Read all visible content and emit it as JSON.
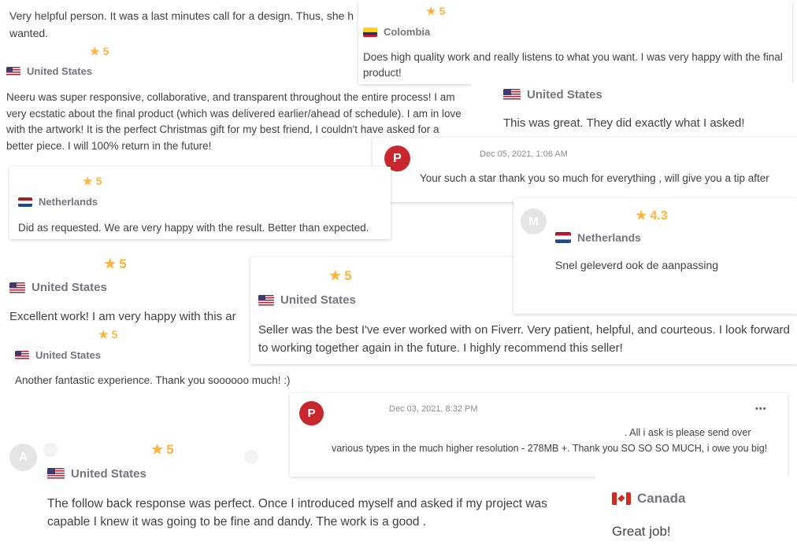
{
  "colors": {
    "star": "#ffb33e",
    "avatar_red": "#c8272e",
    "avatar_grey": "#e4e5e7",
    "country_text": "#74767e",
    "body_text": "#404145"
  },
  "cards": {
    "c1": {
      "text": "Very helpful person. It was a last minutes call for a design. Thus, she h",
      "text2": "wanted."
    },
    "c2": {
      "rating": "5",
      "country": "Colombia",
      "flag": "colombia-flag",
      "text": "Does high quality work and really listens to what you want. I was very happy with the final product!"
    },
    "c3": {
      "rating": "5",
      "country": "United States",
      "flag": "usa-flag",
      "text": "Neeru was super responsive, collaborative, and transparent throughout the entire process! I am very ecstatic about the final product (which was delivered earlier/ahead of schedule). I am in love with the artwork! It is the perfect Christmas gift for my best friend, I couldn't have asked for a better piece. I will 100% return in the future!"
    },
    "c4": {
      "country": "United States",
      "flag": "usa-flag",
      "text": "This was great. They did exactly what I asked!"
    },
    "c5": {
      "avatar": "P",
      "date": "Dec 05, 2021, 1:06 AM",
      "text": "Your such a star thank you so much for everything , will give you a tip after"
    },
    "c6": {
      "rating": "5",
      "country": "Netherlands",
      "flag": "netherlands-flag",
      "text": "Did as requested. We are very happy with the result. Better than expected."
    },
    "c7": {
      "avatar": "M",
      "rating": "4.3",
      "country": "Netherlands",
      "flag": "netherlands-flag",
      "text": "Snel geleverd ook de aanpassing"
    },
    "c8": {
      "rating": "5",
      "country": "United States",
      "flag": "usa-flag",
      "text": "Excellent work! I am very happy with this ar"
    },
    "c9": {
      "rating": "5",
      "country": "United States",
      "flag": "usa-flag",
      "text": "Seller was the best I've ever worked with on Fiverr. Very patient, helpful, and courteous. I look forward to working together again in the future. I highly recommend this seller!"
    },
    "c10": {
      "rating": "5",
      "country": "United States",
      "flag": "usa-flag",
      "text": "Another fantastic experience. Thank you soooooo much! :)"
    },
    "c11": {
      "avatar": "P",
      "date": "Dec 03, 2021, 8:32 PM",
      "more_icon": "more-options-icon",
      "more": "•••",
      "text_lead": ". All i ask is please send over",
      "text": "various types in the much higher resolution - 278MB +. Thank you SO SO SO MUCH, i owe you big!"
    },
    "c12": {
      "avatar": "A",
      "rating": "5",
      "country": "United States",
      "flag": "usa-flag",
      "text": "The follow back response was perfect. Once I introduced myself and asked if my project was capable I knew it was going to be fine and dandy. The work is a good ."
    },
    "c13": {
      "country": "Canada",
      "flag": "canada-flag",
      "text": "Great job!"
    }
  }
}
